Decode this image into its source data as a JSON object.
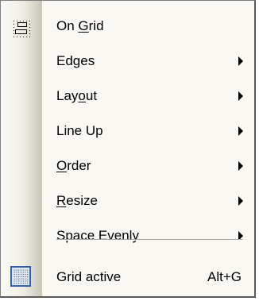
{
  "menu": {
    "items": [
      {
        "label_before": "On ",
        "mnemonic": "G",
        "label_after": "rid",
        "has_submenu": false,
        "icon": "on-grid-icon"
      },
      {
        "label_before": "Edges",
        "mnemonic": "",
        "label_after": "",
        "has_submenu": true
      },
      {
        "label_before": "Lay",
        "mnemonic": "o",
        "label_after": "ut",
        "has_submenu": true
      },
      {
        "label_before": "Line Up",
        "mnemonic": "",
        "label_after": "",
        "has_submenu": true
      },
      {
        "label_before": "",
        "mnemonic": "O",
        "label_after": "rder",
        "has_submenu": true
      },
      {
        "label_before": "",
        "mnemonic": "R",
        "label_after": "esize",
        "has_submenu": true
      },
      {
        "label_before": "Space Evenly",
        "mnemonic": "",
        "label_after": "",
        "has_submenu": true
      }
    ],
    "grid_active": {
      "label": "Grid active",
      "shortcut": "Alt+G",
      "icon": "grid-active-icon",
      "checked": true
    }
  },
  "colors": {
    "menu_background": "#f9f8f3",
    "gutter_dark": "#c9c6b8",
    "active_icon_fill": "#dbe7f7",
    "active_icon_border": "#2f5fa8",
    "text": "#000000"
  }
}
